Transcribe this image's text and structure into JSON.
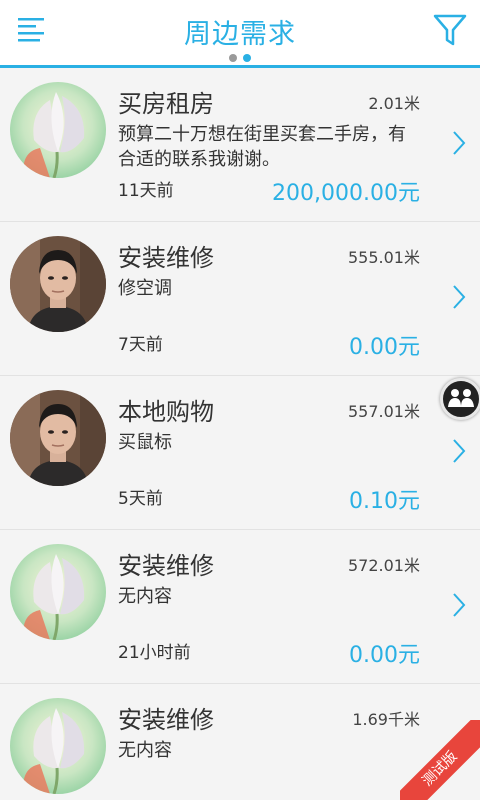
{
  "header": {
    "title": "周边需求",
    "menu_icon": "menu-icon",
    "filter_icon": "filter-icon",
    "pager": {
      "count": 2,
      "active": 2
    }
  },
  "colors": {
    "accent": "#2ab0e4",
    "ribbon": "#e8453c"
  },
  "items": [
    {
      "category": "买房租房",
      "distance": "2.01米",
      "description": "预算二十万想在街里买套二手房，有合适的联系我谢谢。",
      "time": "11天前",
      "price": "200,000.00元",
      "avatar": "flower-avatar"
    },
    {
      "category": "安装维修",
      "distance": "555.01米",
      "description": "修空调",
      "time": "7天前",
      "price": "0.00元",
      "avatar": "person-avatar"
    },
    {
      "category": "本地购物",
      "distance": "557.01米",
      "description": "买鼠标",
      "time": "5天前",
      "price": "0.10元",
      "avatar": "person-avatar"
    },
    {
      "category": "安装维修",
      "distance": "572.01米",
      "description": "无内容",
      "time": "21小时前",
      "price": "0.00元",
      "avatar": "flower-avatar"
    },
    {
      "category": "安装维修",
      "distance": "1.69千米",
      "description": "无内容",
      "time": "",
      "price": "",
      "avatar": "flower-avatar"
    }
  ],
  "floating_button": {
    "icon": "people-group-icon"
  },
  "ribbon": {
    "text": "测试版"
  }
}
